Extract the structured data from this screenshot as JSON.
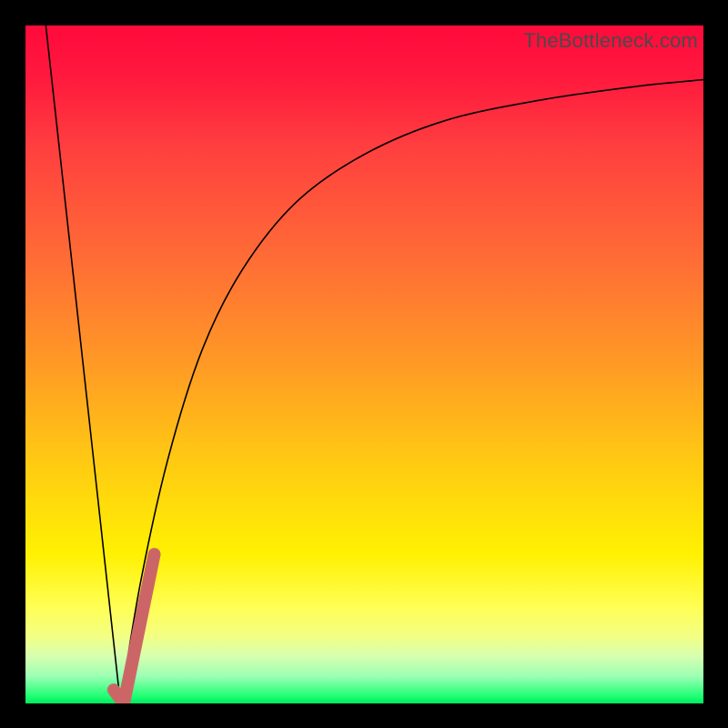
{
  "watermark": "TheBottleneck.com",
  "chart_data": {
    "type": "line",
    "title": "",
    "xlabel": "",
    "ylabel": "",
    "ylim": [
      0,
      100
    ],
    "xlim": [
      0,
      100
    ],
    "series": [
      {
        "name": "left-line-thin",
        "x": [
          3,
          14
        ],
        "y": [
          100,
          0
        ]
      },
      {
        "name": "right-curve-thin",
        "x": [
          14,
          17,
          21,
          26,
          32,
          40,
          50,
          62,
          76,
          90,
          100
        ],
        "y": [
          0,
          18,
          36,
          52,
          64,
          74,
          81,
          86,
          89,
          91,
          92
        ]
      },
      {
        "name": "highlight-thick",
        "x": [
          13,
          14.5,
          19
        ],
        "y": [
          2,
          0,
          22
        ]
      }
    ],
    "colors": {
      "thin_stroke": "#000000",
      "thick_stroke": "#cc6666",
      "gradient_top": "#ff0a3c",
      "gradient_bottom": "#00e860",
      "page_background": "#000000"
    }
  }
}
